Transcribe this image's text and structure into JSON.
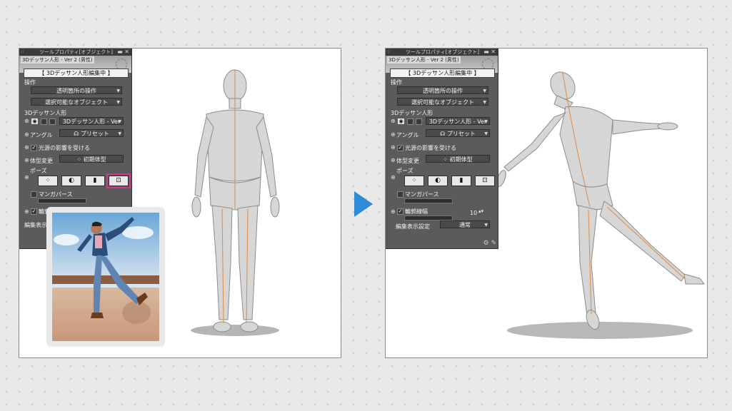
{
  "panel": {
    "title": "ツールプロパティ[オブジェクト]",
    "preview_label": "3Dデッサン人形 - Ver 2 (男性)",
    "mode": "【 3Dデッサン人形編集中 】",
    "operation_label": "操作",
    "operation_value": "透明箇所の操作",
    "select_value": "選択可能なオブジェクト",
    "doll_label": "3Dデッサン人形",
    "doll_value": "3Dデッサン人形 - Ver",
    "angle_label": "アングル",
    "preset_label": "プリセット",
    "light_label": "光源の影響を受ける",
    "body_change_label": "体型変更",
    "initial_body_label": "初期体型",
    "pose_label": "ポーズ",
    "manga_perspective_label": "マンガパース",
    "outline_width_label": "輪郭線幅",
    "outline_width_value": "10",
    "edit_display_label": "編集表示設定",
    "edit_display_value": "通常"
  },
  "colors": {
    "arrow": "#2f8bd8",
    "highlight": "#d2358e",
    "bone": "#e08a3c"
  },
  "icons": [
    "collapse-icon",
    "close-icon",
    "eye-icon",
    "preset-icon",
    "initial-body-icon",
    "pose-scan-icon",
    "pose-head-icon",
    "pose-clipboard-icon",
    "pose-photo-icon",
    "wrench-icon"
  ]
}
